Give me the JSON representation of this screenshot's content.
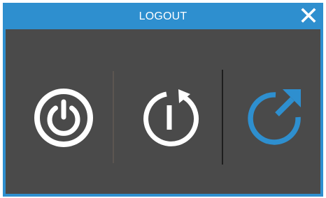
{
  "dialog": {
    "title": "LOGOUT",
    "close_icon": "close-icon",
    "colors": {
      "title_bar": "#2e8fcf",
      "panel": "#4a4a4a",
      "icon": "#ffffff",
      "accent": "#2e8fcf"
    }
  },
  "actions": [
    {
      "icon": "power-icon"
    },
    {
      "icon": "restart-icon"
    },
    {
      "icon": "share-arrow-icon"
    }
  ]
}
